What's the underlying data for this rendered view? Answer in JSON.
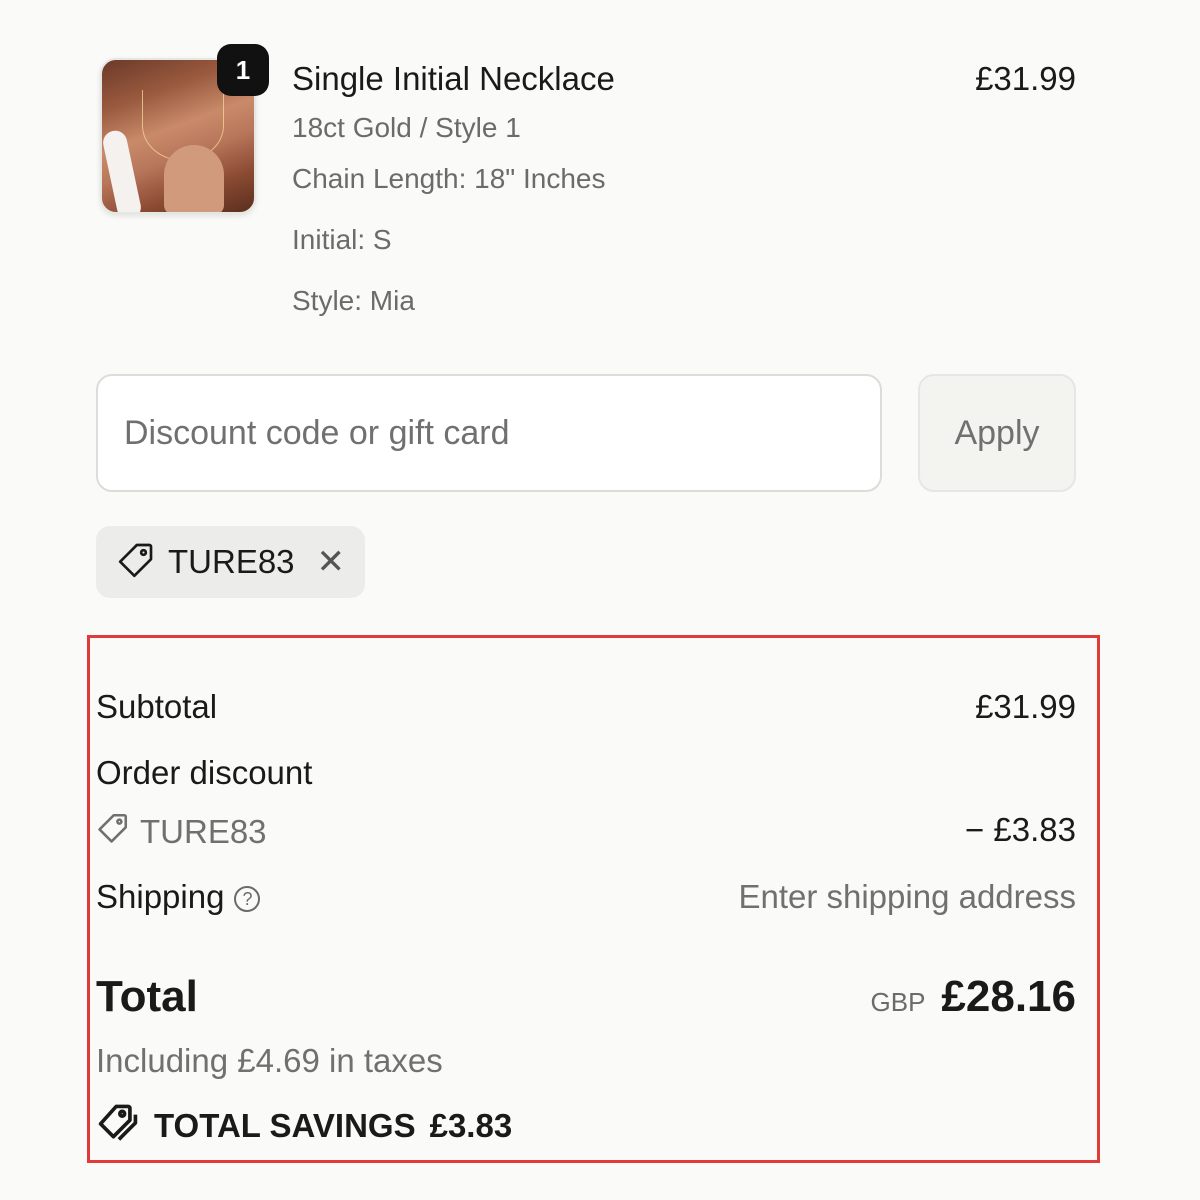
{
  "product": {
    "quantity": "1",
    "name": "Single Initial Necklace",
    "price": "£31.99",
    "variant": "18ct Gold / Style 1",
    "chain_length": "Chain Length: 18\" Inches",
    "initial": "Initial: S",
    "style": "Style: Mia"
  },
  "discount": {
    "placeholder": "Discount code or gift card",
    "apply_label": "Apply",
    "applied_code": "TURE83"
  },
  "summary": {
    "subtotal_label": "Subtotal",
    "subtotal_value": "£31.99",
    "order_discount_label": "Order discount",
    "discount_code": "TURE83",
    "discount_value": "− £3.83",
    "shipping_label": "Shipping",
    "shipping_value": "Enter shipping address",
    "total_label": "Total",
    "currency": "GBP",
    "total_value": "£28.16",
    "tax_note": "Including £4.69 in taxes",
    "savings_label": "TOTAL SAVINGS",
    "savings_value": "£3.83"
  },
  "colors": {
    "background": "#fafaf8",
    "highlight_border": "#e03a3a",
    "badge": "#111111"
  }
}
